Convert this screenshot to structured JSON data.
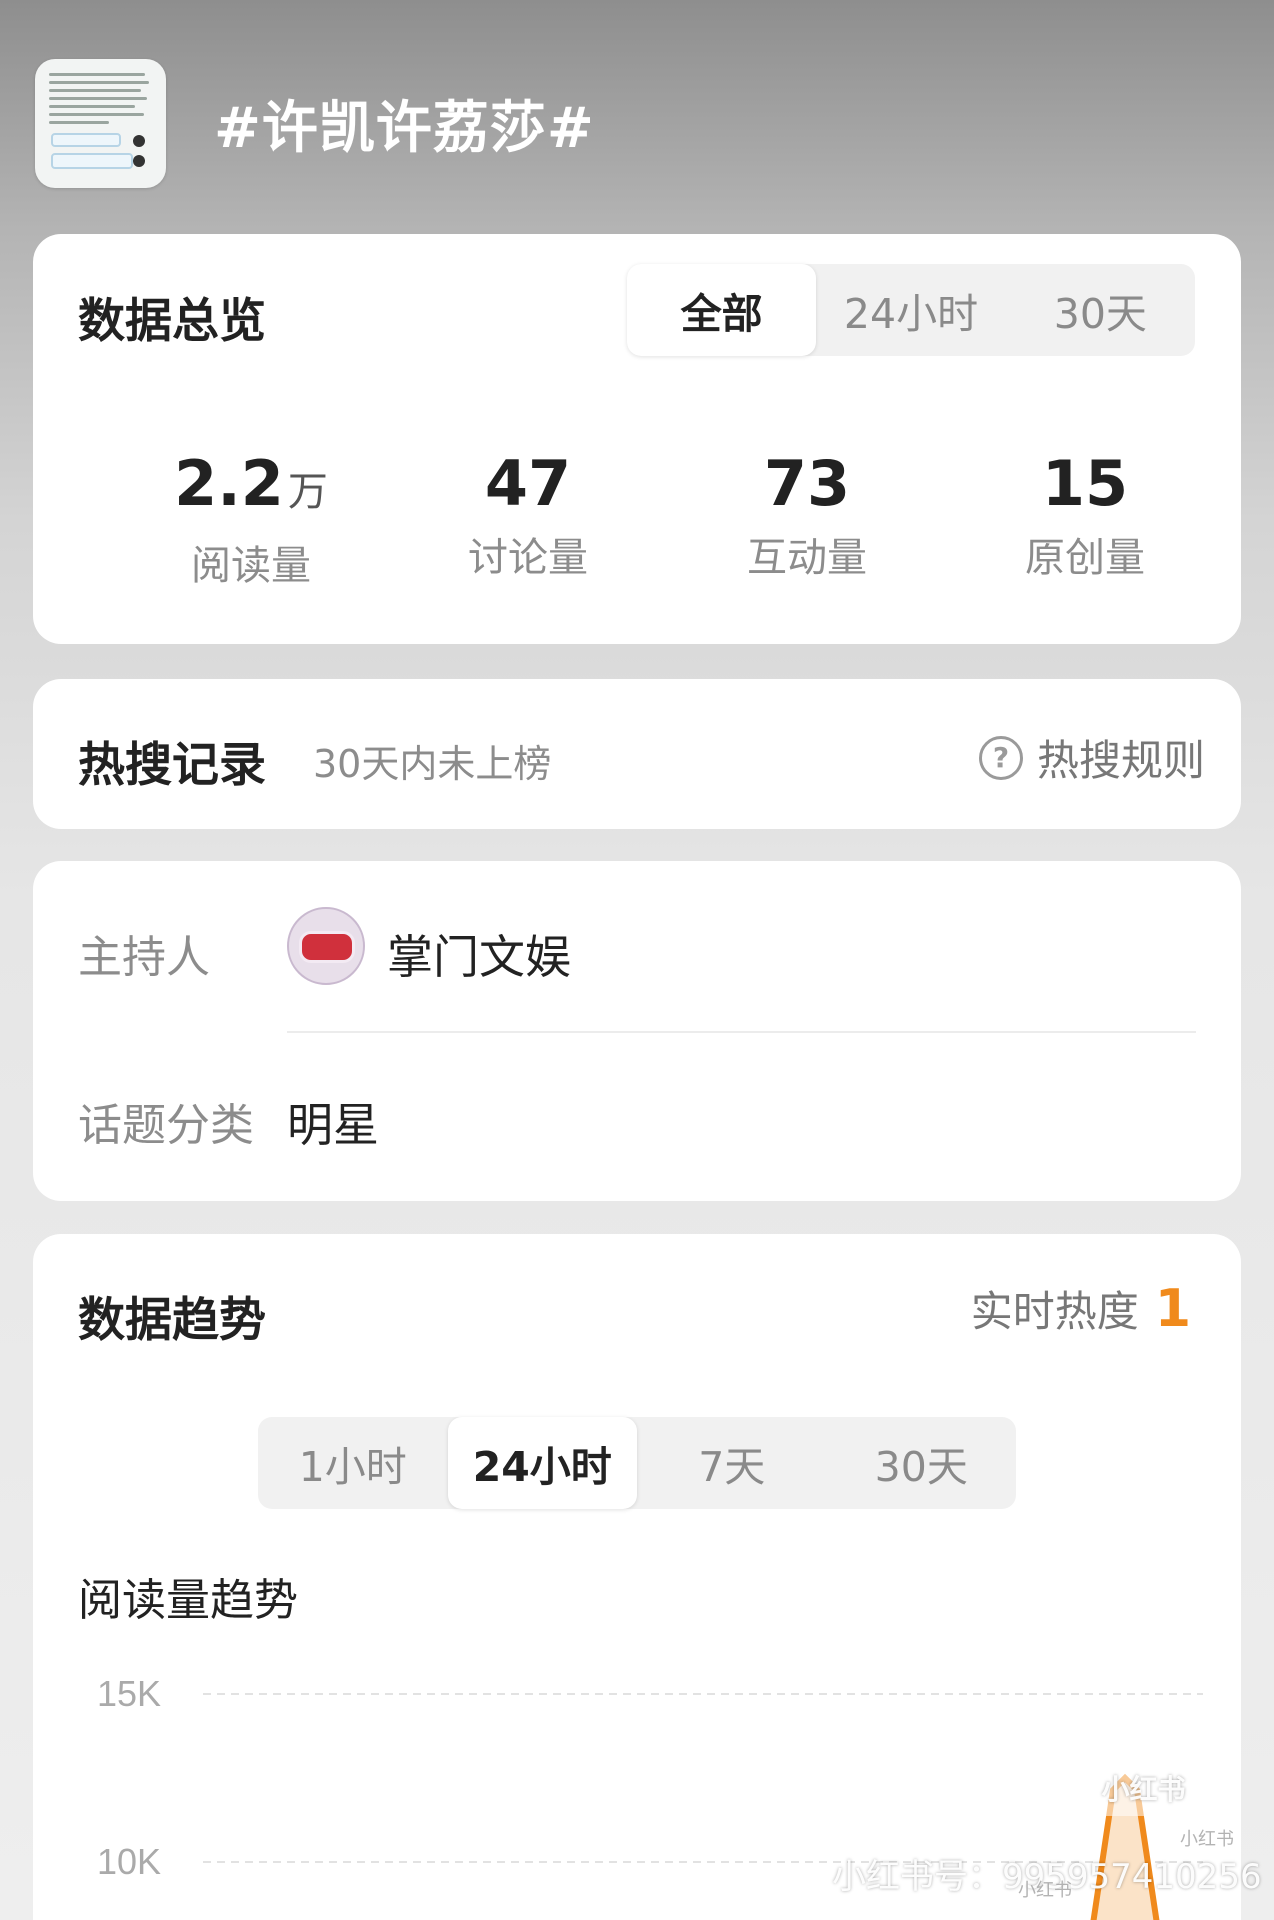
{
  "topic": {
    "title": "#许凯许荔莎#"
  },
  "overview": {
    "title": "数据总览",
    "tabs": [
      "全部",
      "24小时",
      "30天"
    ],
    "active_tab": "全部",
    "stats": [
      {
        "value": "2.2",
        "unit": "万",
        "label": "阅读量"
      },
      {
        "value": "47",
        "unit": "",
        "label": "讨论量"
      },
      {
        "value": "73",
        "unit": "",
        "label": "互动量"
      },
      {
        "value": "15",
        "unit": "",
        "label": "原创量"
      }
    ]
  },
  "hot_search": {
    "title": "热搜记录",
    "status": "30天内未上榜",
    "rules_label": "热搜规则",
    "help_icon": "question-circle-icon"
  },
  "info": {
    "host_label": "主持人",
    "host_name": "掌门文娱",
    "category_label": "话题分类",
    "category_value": "明星"
  },
  "trend": {
    "title": "数据趋势",
    "realtime_label": "实时热度",
    "realtime_value": "1",
    "tabs": [
      "1小时",
      "24小时",
      "7天",
      "30天"
    ],
    "active_tab": "24小时",
    "chart_title": "阅读量趋势",
    "accent_color": "#f08a1c"
  },
  "chart_data": {
    "type": "line",
    "title": "阅读量趋势",
    "y_ticks": [
      "15K",
      "10K"
    ],
    "grid": true,
    "series": [
      {
        "values": []
      }
    ]
  },
  "watermark": {
    "logo": "小红书",
    "id_text": "小红书号：995957410256",
    "small": "小红书"
  }
}
